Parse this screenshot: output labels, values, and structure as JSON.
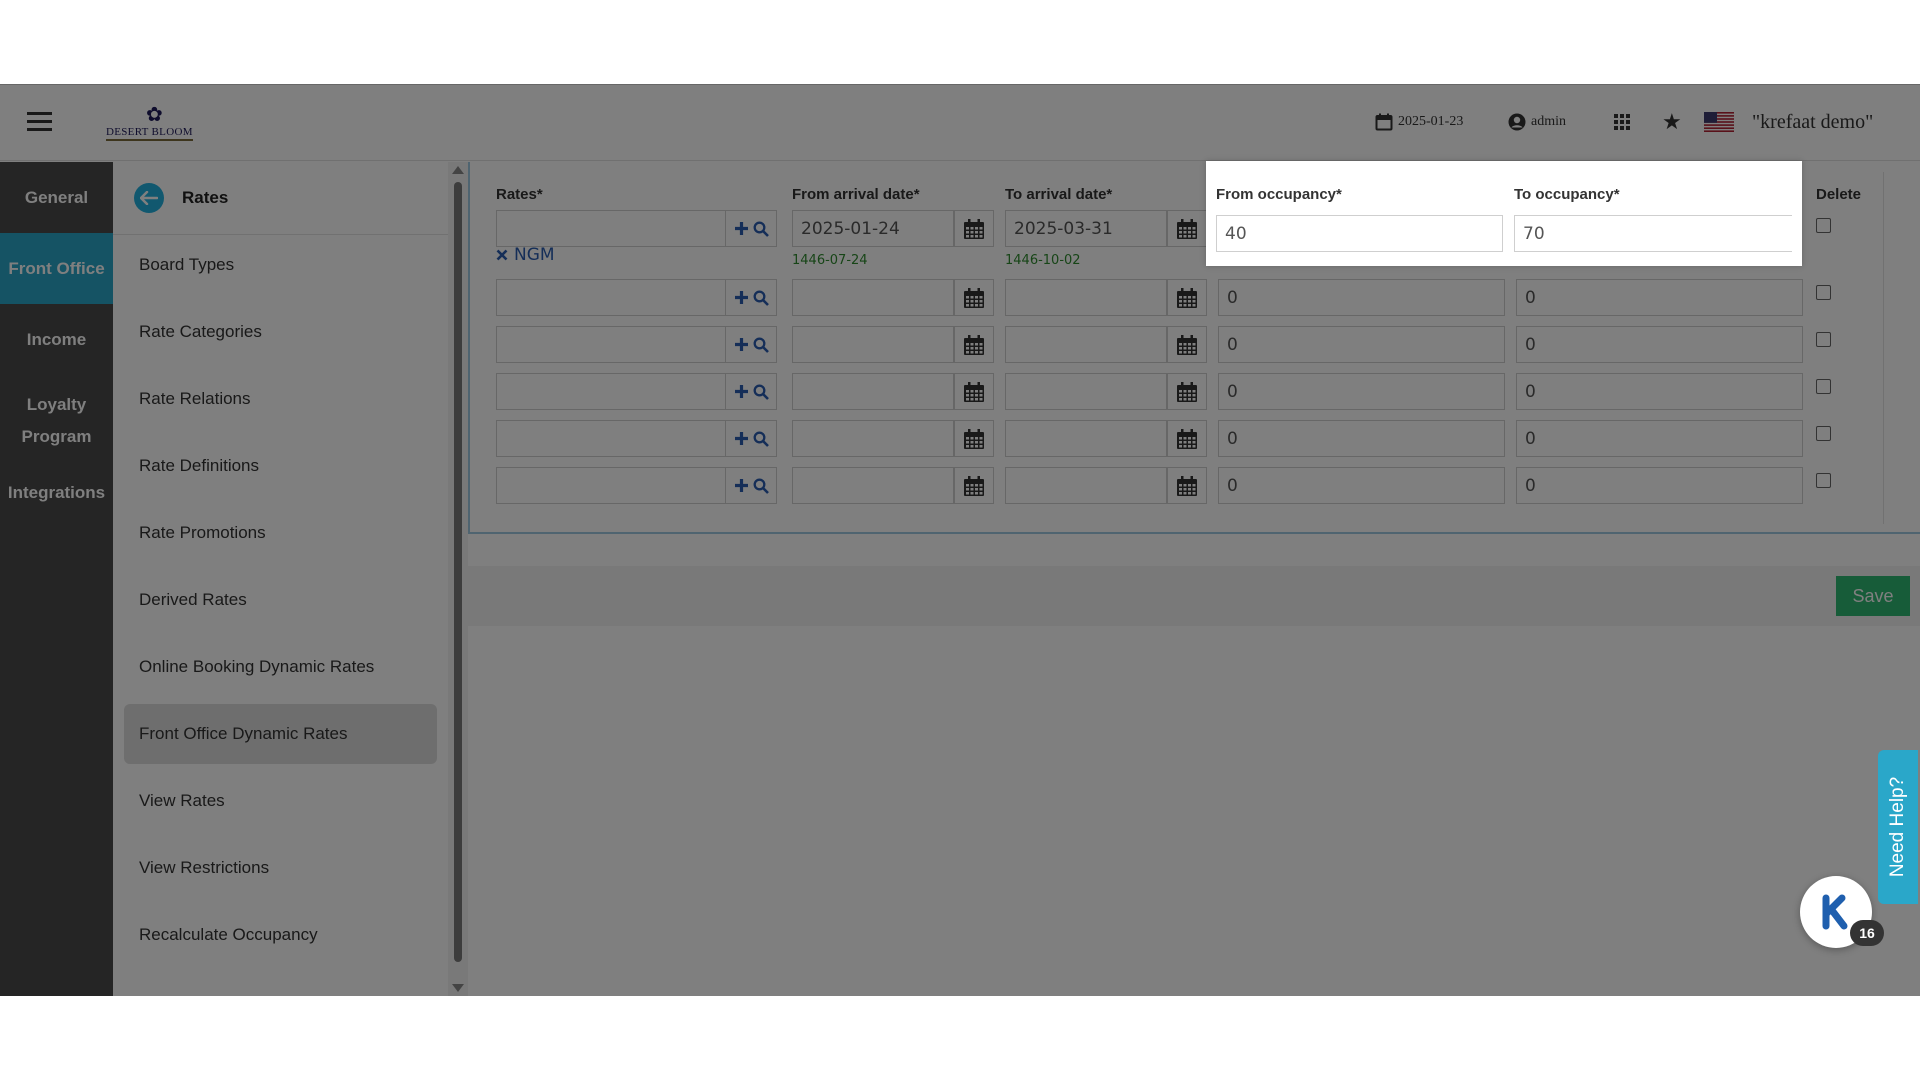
{
  "header": {
    "logo_text": "DESERT BLOOM",
    "date": "2025-01-23",
    "user": "admin",
    "company": "\"krefaat demo\""
  },
  "leftnav": {
    "items": [
      {
        "label": "General",
        "active": false
      },
      {
        "label": "Front Office",
        "active": true
      },
      {
        "label": "Income",
        "active": false
      },
      {
        "label": "Loyalty Program",
        "active": false
      },
      {
        "label": "Integrations",
        "active": false
      }
    ]
  },
  "submenu": {
    "title": "Rates",
    "items": [
      {
        "label": "Board Types",
        "active": false
      },
      {
        "label": "Rate Categories",
        "active": false
      },
      {
        "label": "Rate Relations",
        "active": false
      },
      {
        "label": "Rate Definitions",
        "active": false
      },
      {
        "label": "Rate Promotions",
        "active": false
      },
      {
        "label": "Derived Rates",
        "active": false
      },
      {
        "label": "Online Booking Dynamic Rates",
        "active": false
      },
      {
        "label": "Front Office Dynamic Rates",
        "active": true
      },
      {
        "label": "View Rates",
        "active": false
      },
      {
        "label": "View Restrictions",
        "active": false
      },
      {
        "label": "Recalculate Occupancy",
        "active": false
      }
    ]
  },
  "form": {
    "headers": {
      "rates": "Rates*",
      "from_arrival": "From arrival date*",
      "to_arrival": "To arrival date*",
      "from_occupancy": "From occupancy*",
      "to_occupancy": "To occupancy*",
      "delete": "Delete"
    },
    "first_row": {
      "rate": "",
      "rate_tag": "NGM",
      "from_arrival": "2025-01-24",
      "from_arrival_hijri": "1446-07-24",
      "to_arrival": "2025-03-31",
      "to_arrival_hijri": "1446-10-02",
      "from_occupancy": "40",
      "to_occupancy": "70"
    },
    "rows": [
      {
        "rate": "",
        "from_arrival": "",
        "to_arrival": "",
        "from_occupancy": "0",
        "to_occupancy": "0"
      },
      {
        "rate": "",
        "from_arrival": "",
        "to_arrival": "",
        "from_occupancy": "0",
        "to_occupancy": "0"
      },
      {
        "rate": "",
        "from_arrival": "",
        "to_arrival": "",
        "from_occupancy": "0",
        "to_occupancy": "0"
      },
      {
        "rate": "",
        "from_arrival": "",
        "to_arrival": "",
        "from_occupancy": "0",
        "to_occupancy": "0"
      },
      {
        "rate": "",
        "from_arrival": "",
        "to_arrival": "",
        "from_occupancy": "0",
        "to_occupancy": "0"
      }
    ]
  },
  "actions": {
    "save_label": "Save"
  },
  "help": {
    "need_help_label": "Need Help?",
    "chat_badge": "16"
  },
  "colors": {
    "accent": "#2aa7c9",
    "save": "#2eb872",
    "nav_bg": "#4a4a4a"
  }
}
